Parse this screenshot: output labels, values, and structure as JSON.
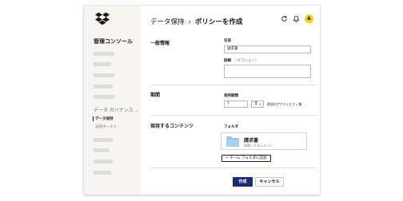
{
  "sidebar": {
    "logo_icon": "dropbox-logo",
    "title": "管理コンソール",
    "group_label": "データ ガバナンス",
    "group_chevron": "⌄",
    "items": [
      {
        "label": "データ保持",
        "active": true
      },
      {
        "label": "法的ホールド",
        "active": false
      }
    ]
  },
  "header": {
    "breadcrumb_parent": "データ保持",
    "breadcrumb_separator": "›",
    "breadcrumb_current": "ポリシーを作成",
    "icons": [
      "refresh-icon",
      "bell-icon",
      "avatar"
    ],
    "avatar_initial": "A",
    "avatar_color": "#f5d21f"
  },
  "general": {
    "section_title": "一般情報",
    "name_label": "名前",
    "name_value": "請求書",
    "details_label": "詳細",
    "details_optional": "（オプション）",
    "details_value": ""
  },
  "period": {
    "section_title": "期間",
    "retention_label": "保持期間",
    "retention_value": "7",
    "unit_value": "年",
    "note": "前回のアクティビティ後"
  },
  "content": {
    "section_title": "保持するコンテンツ",
    "folder_label": "フォルダ",
    "folder_name": "請求書",
    "folder_path": "財務 › ドキュメント",
    "add_button": "チーム フォルダに追加",
    "add_icon": "+"
  },
  "actions": {
    "create": "作成",
    "cancel": "キャンセル",
    "accent": "#1e2b78"
  }
}
